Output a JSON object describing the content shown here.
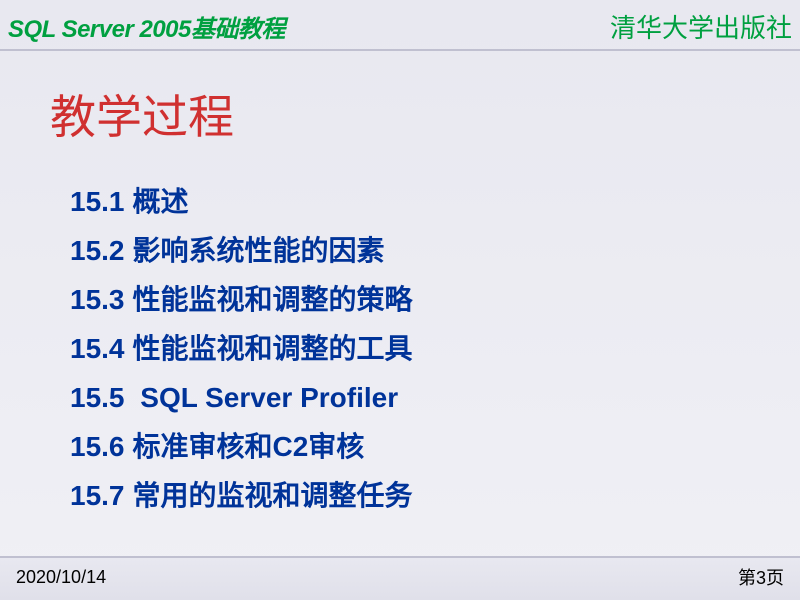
{
  "header": {
    "left": "SQL Server 2005基础教程",
    "right": "清华大学出版社"
  },
  "title": "教学过程",
  "toc": [
    {
      "num": "15.1",
      "label": "概述"
    },
    {
      "num": "15.2",
      "label": "影响系统性能的因素"
    },
    {
      "num": "15.3",
      "label": "性能监视和调整的策略"
    },
    {
      "num": "15.4",
      "label": "性能监视和调整的工具"
    },
    {
      "num": "15.5",
      "label": " SQL Server Profiler"
    },
    {
      "num": "15.6",
      "label": "标准审核和C2审核"
    },
    {
      "num": "15.7",
      "label": "常用的监视和调整任务"
    }
  ],
  "footer": {
    "date": "2020/10/14",
    "page": "第3页"
  }
}
